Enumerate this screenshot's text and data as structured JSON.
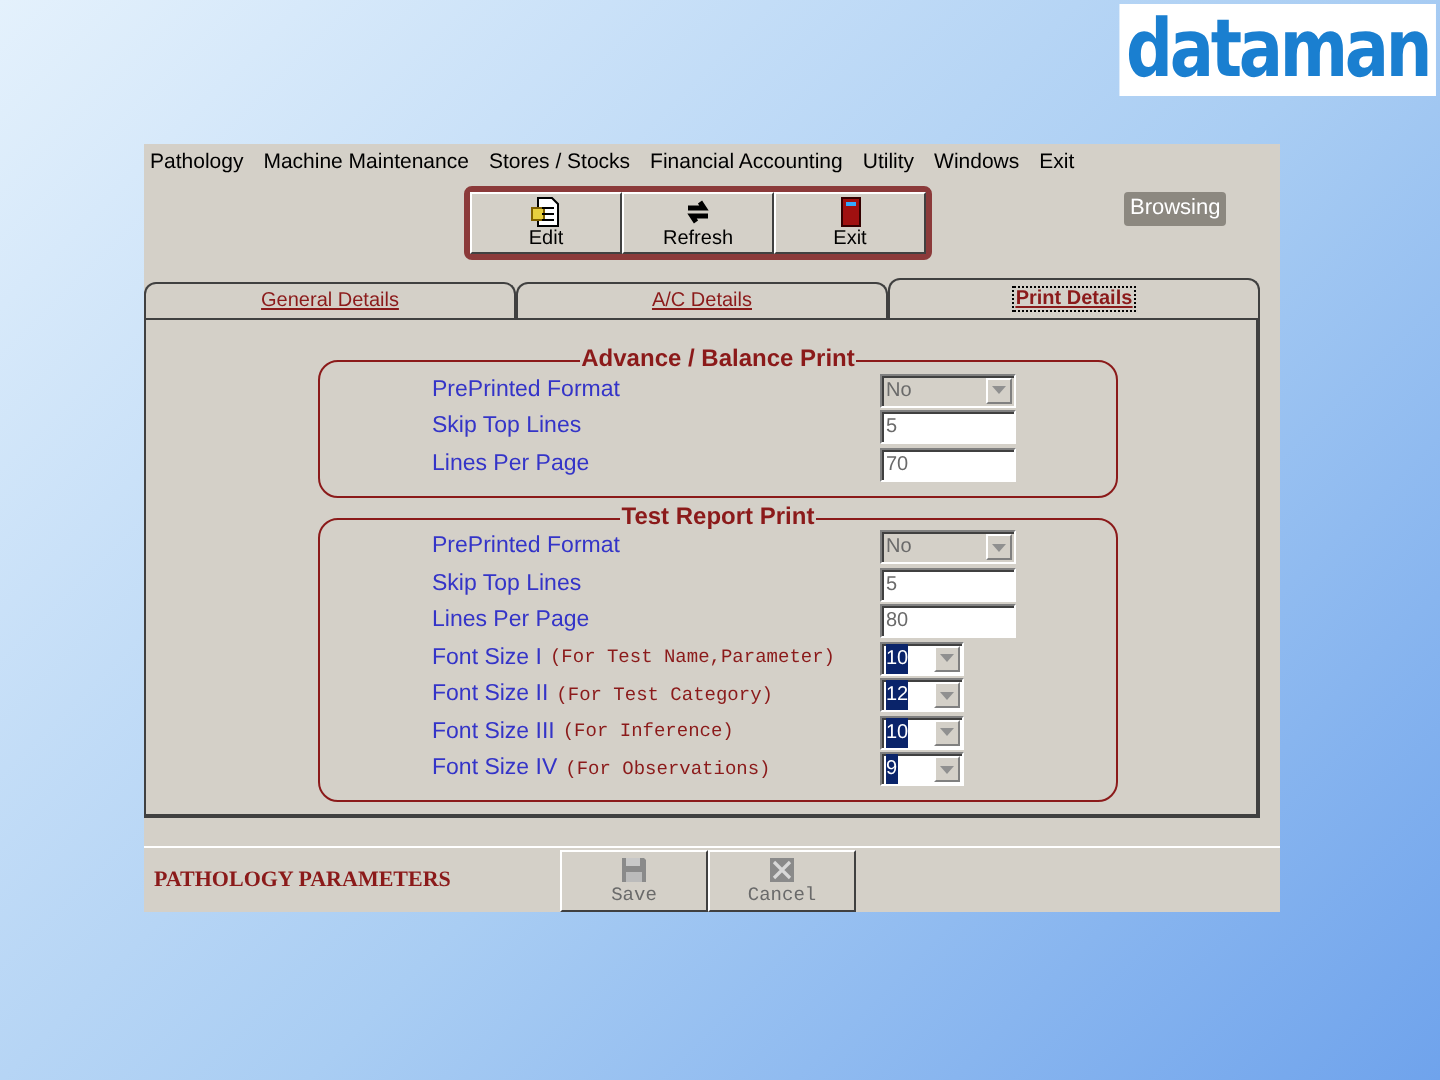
{
  "logo": {
    "text": "dataman"
  },
  "menu": [
    "Pathology",
    "Machine Maintenance",
    "Stores / Stocks",
    "Financial Accounting",
    "Utility",
    "Windows",
    "Exit"
  ],
  "toolbar": {
    "buttons": [
      {
        "label": "Edit",
        "kind": "edit"
      },
      {
        "label": "Refresh",
        "kind": "refresh"
      },
      {
        "label": "Exit",
        "kind": "exit"
      }
    ],
    "status": "Browsing"
  },
  "tabs": [
    {
      "label": "General Details",
      "selected": false
    },
    {
      "label": "A/C Details",
      "selected": false
    },
    {
      "label": "Print Details",
      "selected": true
    }
  ],
  "sections": [
    {
      "title": "Advance / Balance Print",
      "rows": [
        {
          "label": "PrePrinted Format",
          "kind": "combo",
          "value": "No",
          "disabled": true,
          "selected": false
        },
        {
          "label": "Skip Top Lines",
          "kind": "text",
          "value": "5",
          "disabled": true,
          "selected": false
        },
        {
          "label": "Lines Per Page",
          "kind": "text",
          "value": "70",
          "disabled": true,
          "selected": false
        }
      ]
    },
    {
      "title": "Test Report Print",
      "rows": [
        {
          "label": "PrePrinted Format",
          "kind": "combo",
          "value": "No",
          "disabled": true,
          "selected": false
        },
        {
          "label": "Skip Top Lines",
          "kind": "text",
          "value": "5",
          "disabled": true,
          "selected": false
        },
        {
          "label": "Lines Per Page",
          "kind": "text",
          "value": "80",
          "disabled": true,
          "selected": false
        },
        {
          "label": "Font Size I",
          "hint": "(For Test Name,Parameter)",
          "kind": "small-combo",
          "value": "10",
          "disabled": false,
          "selected": true
        },
        {
          "label": "Font Size II",
          "hint": "(For Test Category)",
          "kind": "small-combo",
          "value": "12",
          "disabled": false,
          "selected": true
        },
        {
          "label": "Font Size III",
          "hint": "(For Inference)",
          "kind": "small-combo",
          "value": "10",
          "disabled": false,
          "selected": true
        },
        {
          "label": "Font Size IV",
          "hint": "(For Observations)",
          "kind": "small-combo",
          "value": "9",
          "disabled": false,
          "selected": true
        }
      ]
    }
  ],
  "footer": {
    "title": "PATHOLOGY PARAMETERS",
    "buttons": [
      {
        "label": "Save",
        "kind": "save",
        "disabled": true
      },
      {
        "label": "Cancel",
        "kind": "cancel",
        "disabled": true
      }
    ]
  }
}
